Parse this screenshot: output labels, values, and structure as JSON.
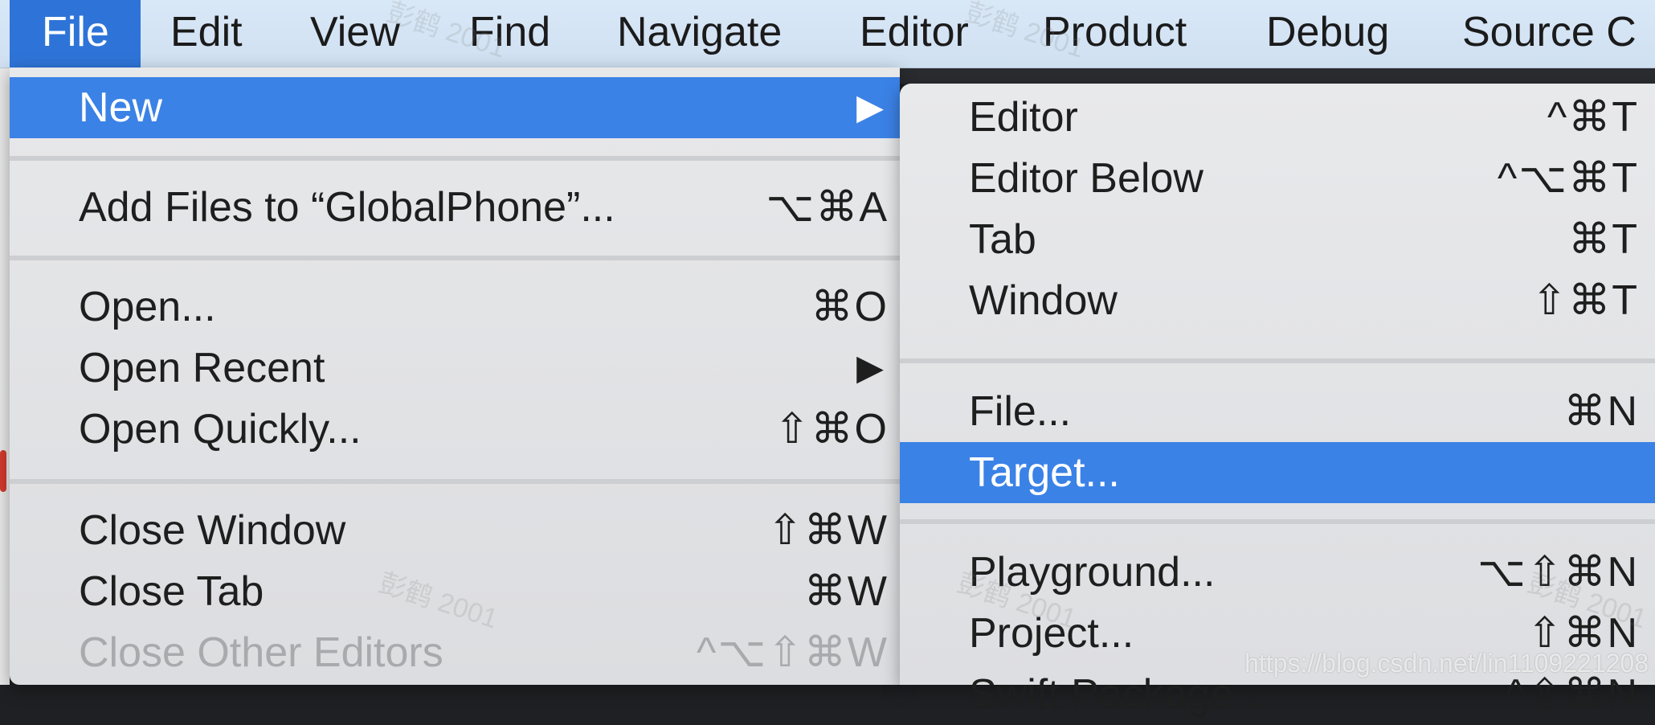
{
  "menubar": {
    "items": [
      {
        "label": "File"
      },
      {
        "label": "Edit"
      },
      {
        "label": "View"
      },
      {
        "label": "Find"
      },
      {
        "label": "Navigate"
      },
      {
        "label": "Editor"
      },
      {
        "label": "Product"
      },
      {
        "label": "Debug"
      },
      {
        "label": "Source C"
      }
    ]
  },
  "file_menu": {
    "new": {
      "label": "New",
      "submenu_arrow": "▶"
    },
    "add_files": {
      "label": "Add Files to “GlobalPhone”...",
      "shortcut": "⌥⌘A"
    },
    "open": {
      "label": "Open...",
      "shortcut": "⌘O"
    },
    "open_recent": {
      "label": "Open Recent",
      "submenu_arrow": "▶"
    },
    "open_quickly": {
      "label": "Open Quickly...",
      "shortcut": "⇧⌘O"
    },
    "close_window": {
      "label": "Close Window",
      "shortcut": "⇧⌘W"
    },
    "close_tab": {
      "label": "Close Tab",
      "shortcut": "⌘W"
    },
    "close_other_editors": {
      "label": "Close Other Editors",
      "shortcut": "^⌥⇧⌘W"
    }
  },
  "new_submenu": {
    "editor": {
      "label": "Editor",
      "shortcut": "^⌘T"
    },
    "editor_below": {
      "label": "Editor Below",
      "shortcut": "^⌥⌘T"
    },
    "tab": {
      "label": "Tab",
      "shortcut": "⌘T"
    },
    "window": {
      "label": "Window",
      "shortcut": "⇧⌘T"
    },
    "file": {
      "label": "File...",
      "shortcut": "⌘N"
    },
    "target": {
      "label": "Target..."
    },
    "playground": {
      "label": "Playground...",
      "shortcut": "⌥⇧⌘N"
    },
    "project": {
      "label": "Project...",
      "shortcut": "⇧⌘N"
    },
    "swift_package": {
      "label": "Swift Package...",
      "shortcut": "^⇧⌘N"
    }
  },
  "watermark": {
    "text": "彭鹤 2001",
    "url": "https://blog.csdn.net/lin1109221208"
  },
  "colors": {
    "highlight": "#3b82e6",
    "menubar_active": "#2e74d8",
    "menu_bg": "#e2e3e5",
    "disabled_text": "#a9aaad"
  }
}
